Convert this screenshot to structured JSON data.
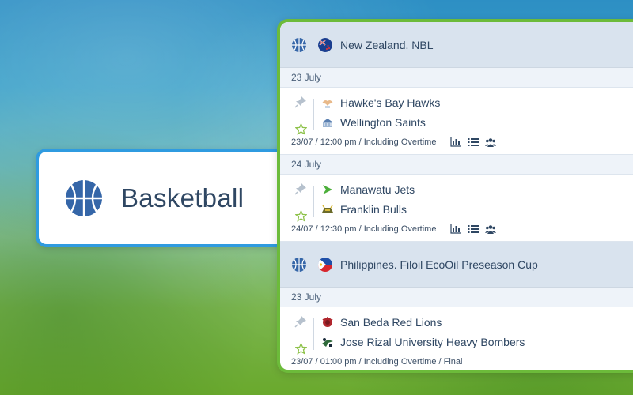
{
  "sport": {
    "label": "Basketball",
    "icon": "basketball-icon"
  },
  "colors": {
    "accent_blue": "#2f9be0",
    "accent_green": "#6cbb3a",
    "text": "#2f4763"
  },
  "leagues": [
    {
      "name": "New Zealand. NBL",
      "sections": [
        {
          "date": "23 July",
          "match": {
            "team1": "Hawke's Bay Hawks",
            "team2": "Wellington Saints",
            "info": "23/07 / 12:00 pm / Including Overtime"
          }
        },
        {
          "date": "24 July",
          "match": {
            "team1": "Manawatu Jets",
            "team2": "Franklin Bulls",
            "info": "24/07 / 12:30 pm / Including Overtime"
          }
        }
      ]
    },
    {
      "name": "Philippines. Filoil EcoOil Preseason Cup",
      "sections": [
        {
          "date": "23 July",
          "match": {
            "team1": "San Beda Red Lions",
            "team2": "Jose Rizal University Heavy Bombers",
            "info": "23/07 / 01:00 pm / Including Overtime / Final"
          }
        }
      ]
    }
  ]
}
